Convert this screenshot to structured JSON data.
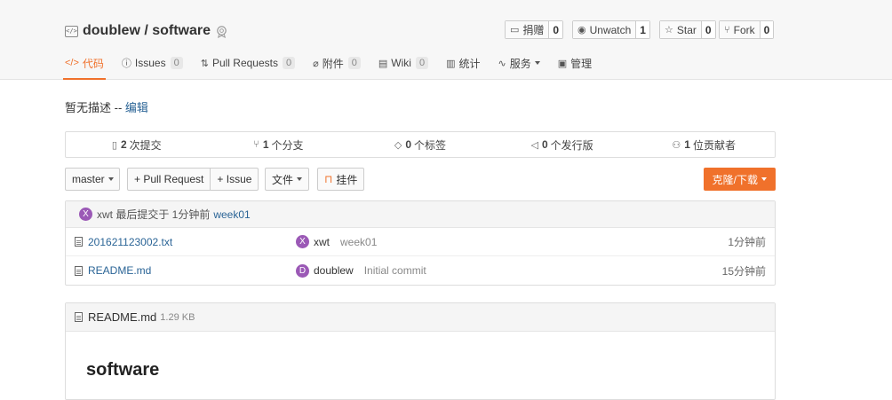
{
  "repo": {
    "title": "doublew / software"
  },
  "actions": [
    {
      "label": "捐赠",
      "count": "0",
      "icon": "donate-icon"
    },
    {
      "label": "Unwatch",
      "count": "1",
      "icon": "eye-icon"
    },
    {
      "label": "Star",
      "count": "0",
      "icon": "star-icon"
    },
    {
      "label": "Fork",
      "count": "0",
      "icon": "fork-icon"
    }
  ],
  "tabs": [
    {
      "label": "代码",
      "count": null,
      "icon": "code-icon",
      "active": true
    },
    {
      "label": "Issues",
      "count": "0",
      "icon": "issue-icon"
    },
    {
      "label": "Pull Requests",
      "count": "0",
      "icon": "pull-request-icon"
    },
    {
      "label": "附件",
      "count": "0",
      "icon": "attachment-icon"
    },
    {
      "label": "Wiki",
      "count": "0",
      "icon": "wiki-icon"
    },
    {
      "label": "统计",
      "count": null,
      "icon": "stats-icon"
    },
    {
      "label": "服务",
      "count": null,
      "icon": "service-icon",
      "dropdown": true
    },
    {
      "label": "管理",
      "count": null,
      "icon": "settings-icon"
    }
  ],
  "description": {
    "text": "暂无描述 -- ",
    "edit_link": "编辑"
  },
  "stats": [
    {
      "num": "2",
      "label": "次提交",
      "icon": "commit-icon"
    },
    {
      "num": "1",
      "label": "个分支",
      "icon": "branch-icon"
    },
    {
      "num": "0",
      "label": "个标签",
      "icon": "tag-icon"
    },
    {
      "num": "0",
      "label": "个发行版",
      "icon": "release-icon"
    },
    {
      "num": "1",
      "label": "位贡献者",
      "icon": "contributor-icon"
    }
  ],
  "toolbar": {
    "branch": "master",
    "new_pr": "+ Pull Request",
    "new_issue": "+ Issue",
    "file_menu": "文件",
    "widget": "挂件",
    "clone": "克隆/下载"
  },
  "last_commit": {
    "avatar": "X",
    "text": "xwt 最后提交于 1分钟前",
    "message": "week01"
  },
  "files": [
    {
      "name": "201621123002.txt",
      "avatar": "X",
      "author": "xwt",
      "message": "week01",
      "time": "1分钟前"
    },
    {
      "name": "README.md",
      "avatar": "D",
      "author": "doublew",
      "message": "Initial commit",
      "time": "15分钟前"
    }
  ],
  "readme": {
    "filename": "README.md",
    "size": "1.29 KB",
    "heading": "software"
  },
  "colors": {
    "accent": "#f0712b",
    "link": "#2a6496",
    "avatar": "#9b59b6"
  }
}
